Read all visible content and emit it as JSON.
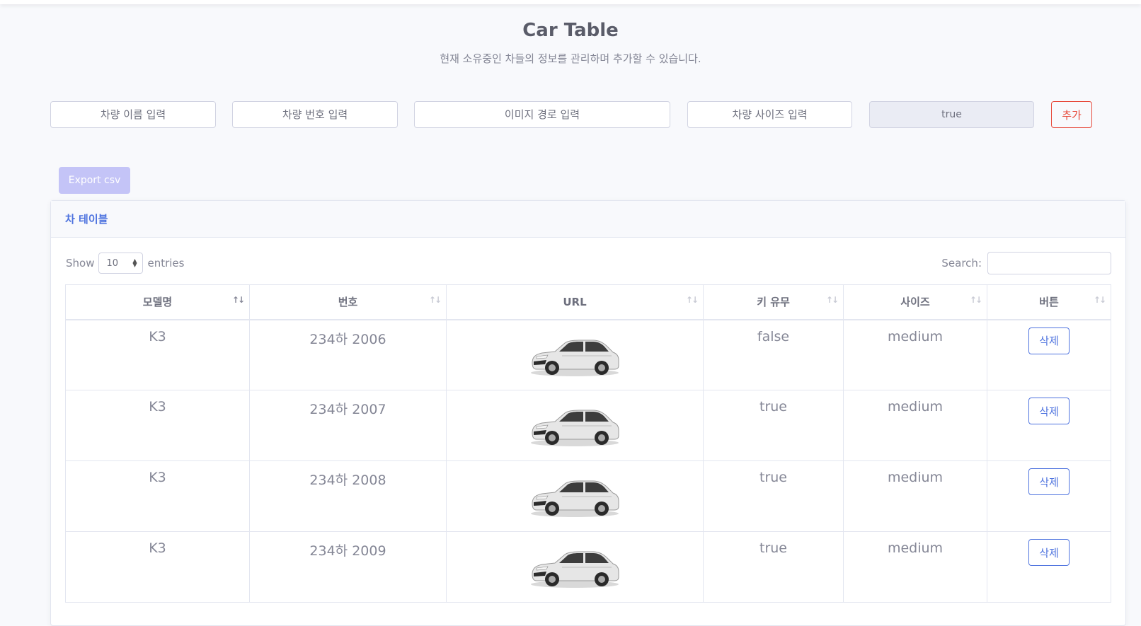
{
  "page": {
    "title": "Car Table",
    "subtitle": "현재 소유중인 차들의 정보를 관리하며 추가할 수 있습니다."
  },
  "form": {
    "name_placeholder": "차량 이름 입력",
    "number_placeholder": "차량 번호 입력",
    "image_placeholder": "이미지 경로 입력",
    "size_placeholder": "차량 사이즈 입력",
    "key_value": "true",
    "add_label": "추가"
  },
  "toolbar": {
    "export_label": "Export csv"
  },
  "card": {
    "title": "차 테이블"
  },
  "datatable": {
    "show_label": "Show",
    "page_length": "10",
    "entries_label": "entries",
    "search_label": "Search:"
  },
  "columns": [
    "모델명",
    "번호",
    "URL",
    "키 유무",
    "사이즈",
    "버튼"
  ],
  "rows": [
    {
      "model": "K3",
      "number": "234하 2006",
      "image": "car-image",
      "key": "false",
      "size": "medium",
      "button": "삭제"
    },
    {
      "model": "K3",
      "number": "234하 2007",
      "image": "car-image",
      "key": "true",
      "size": "medium",
      "button": "삭제"
    },
    {
      "model": "K3",
      "number": "234하 2008",
      "image": "car-image",
      "key": "true",
      "size": "medium",
      "button": "삭제"
    },
    {
      "model": "K3",
      "number": "234하 2009",
      "image": "car-image",
      "key": "true",
      "size": "medium",
      "button": "삭제"
    }
  ],
  "colors": {
    "primary": "#4e73df",
    "danger": "#e74a3b",
    "export": "#c4c4f7"
  },
  "icons": {
    "sort": "sort-icon",
    "select": "chevron-updown-icon"
  }
}
